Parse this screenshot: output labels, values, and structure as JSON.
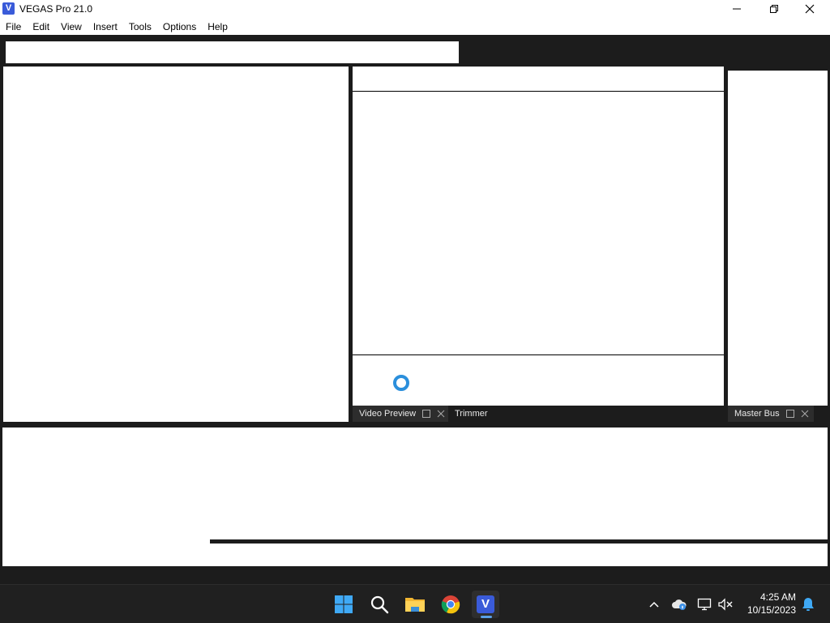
{
  "window": {
    "app_icon_letter": "V",
    "title": "VEGAS Pro 21.0"
  },
  "menu": {
    "items": [
      "File",
      "Edit",
      "View",
      "Insert",
      "Tools",
      "Options",
      "Help"
    ]
  },
  "tabs": {
    "video_preview": "Video Preview",
    "trimmer": "Trimmer",
    "master_bus": "Master Bus"
  },
  "taskbar": {
    "vegas_letter": "V",
    "time": "4:25 AM",
    "date": "10/15/2023"
  },
  "colors": {
    "vegas_blue": "#3a5bd9",
    "spinner_blue": "#2b8fdc",
    "dark_bg": "#1c1c1c"
  },
  "icons": [
    "app-icon",
    "minimize-icon",
    "restore-icon",
    "close-icon",
    "float-window-icon",
    "close-tab-icon",
    "windows-start-icon",
    "search-icon",
    "file-explorer-icon",
    "chrome-icon",
    "vegas-icon",
    "chevron-up-icon",
    "cloud-icon",
    "network-icon",
    "volume-muted-icon",
    "bell-icon"
  ]
}
